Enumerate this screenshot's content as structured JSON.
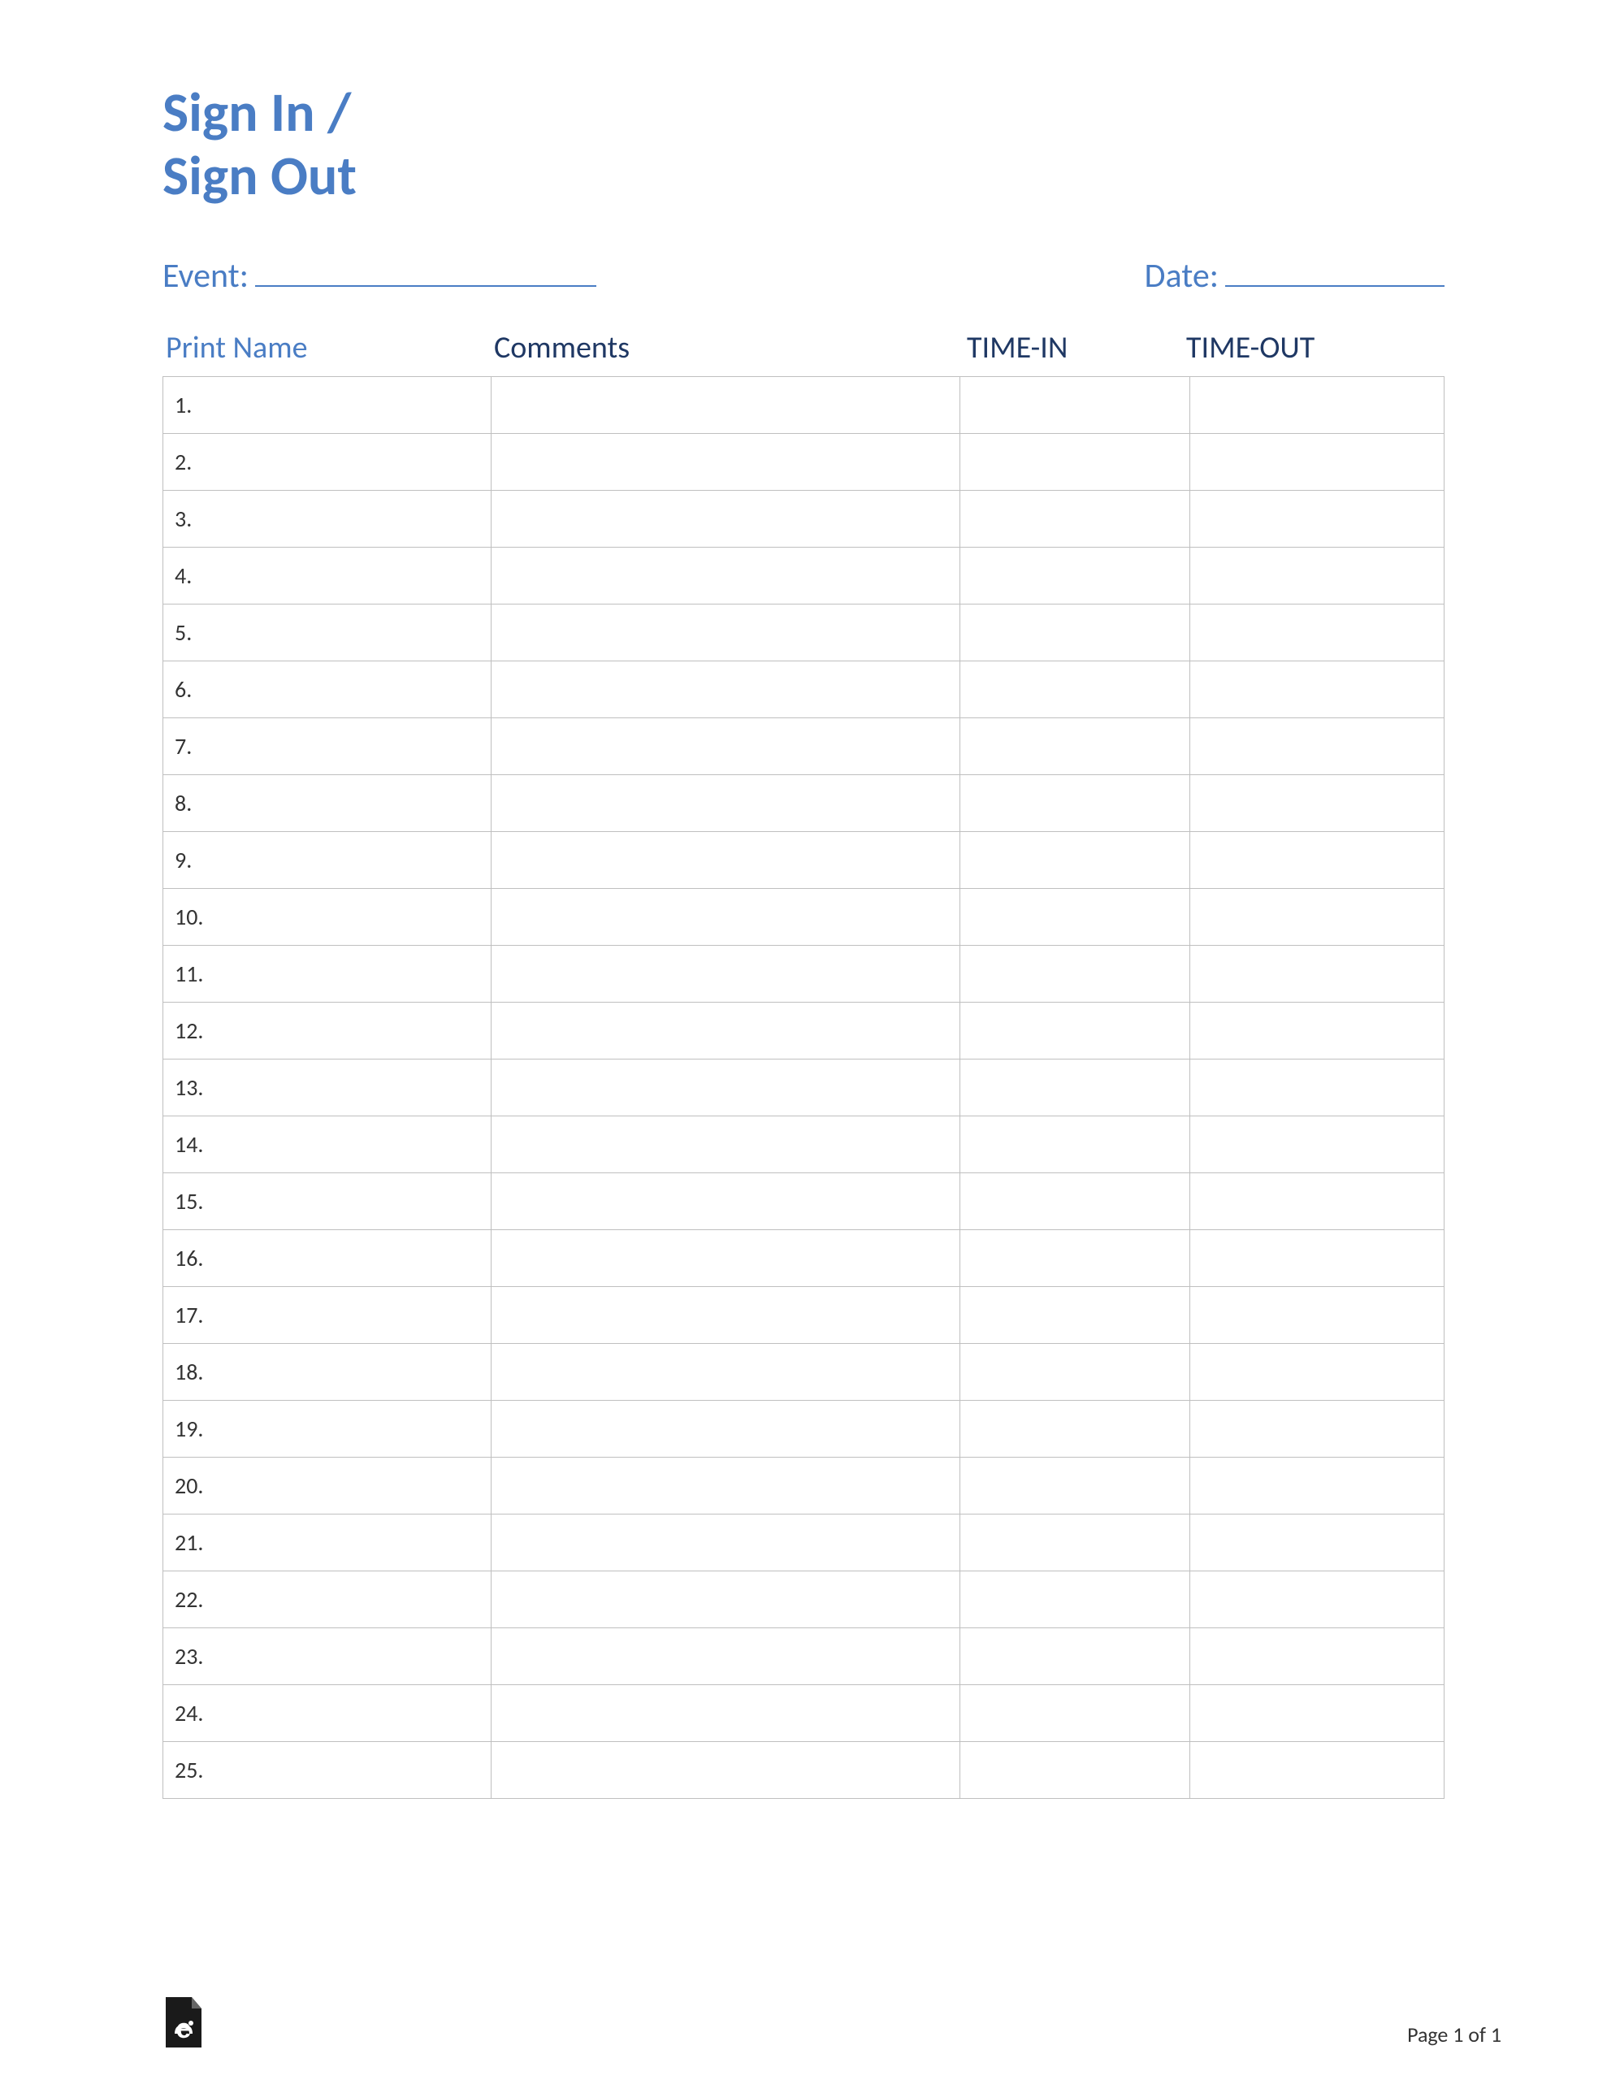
{
  "title_line1": "Sign In /",
  "title_line2": "Sign Out",
  "event_label": "Event:",
  "date_label": "Date:",
  "headers": {
    "name": "Print Name",
    "comments": "Comments",
    "timein": "TIME-IN",
    "timeout": "TIME-OUT"
  },
  "rows": [
    "1.",
    "2.",
    "3.",
    "4.",
    "5.",
    "6.",
    "7.",
    "8.",
    "9.",
    "10.",
    "11.",
    "12.",
    "13.",
    "14.",
    "15.",
    "16.",
    "17.",
    "18.",
    "19.",
    "20.",
    "21.",
    "22.",
    "23.",
    "24.",
    "25."
  ],
  "footer": {
    "page": "Page 1 of 1"
  }
}
